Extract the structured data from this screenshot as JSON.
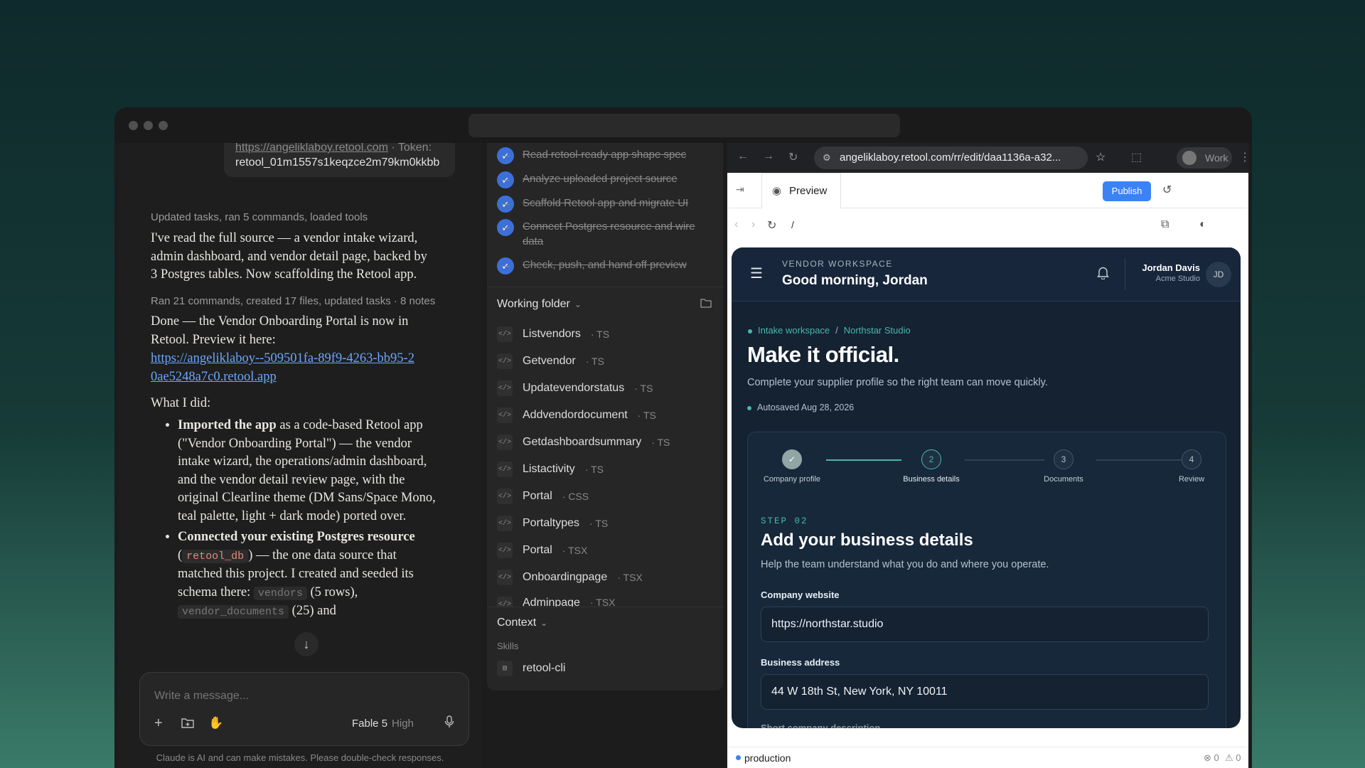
{
  "colors": {
    "accent_teal": "#49b7a9",
    "publish_blue": "#3b82f6",
    "task_check": "#3d6fd8",
    "link": "#6aa7ff"
  },
  "chat": {
    "bubble_link": "https://angeliklaboy.retool.com",
    "bubble_suffix": " · Token:",
    "bubble_token": "retool_01m1557s1keqzce2m79km0kkbb",
    "meta1": "Updated tasks, ran 5 commands, loaded tools",
    "para1": "I've read the full source — a vendor intake wizard, admin dashboard, and vendor detail page, backed by 3 Postgres tables. Now scaffolding the Retool app.",
    "meta2": "Ran 21 commands, created 17 files, updated tasks · 8 notes",
    "para2": "Done — the Vendor Onboarding Portal is now in Retool. Preview it here:",
    "preview_link": "https://angeliklaboy--509501fa-89f9-4263-bb95-20ae5248a7c0.retool.app",
    "what_i_did": "What I did:",
    "b1_bold": "Imported the app",
    "b1_text": " as a code-based Retool app (\"Vendor Onboarding Portal\") — the vendor intake wizard, the operations/admin dashboard, and the vendor detail review page, with the original Clearline theme (DM Sans/Space Mono, teal palette, light + dark mode) ported over.",
    "b2_bold": "Connected your existing Postgres resource",
    "b2_pre": " (",
    "b2_code": "retool_db",
    "b2_text": ") — the one data source that matched this project. I created and seeded its schema there:",
    "b2_code2": "vendors",
    "b2_tail": "(5 rows),",
    "b2_code3": "vendor_documents",
    "b2_tail2": "(25) and",
    "scroll_icon": "arrow-down-icon",
    "input_placeholder": "Write a message...",
    "model": "Fable 5",
    "effort": "High",
    "disclaimer": "Claude is AI and can make mistakes. Please double-check responses."
  },
  "tasks": {
    "items": [
      "Read retool-ready app shape spec",
      "Analyze uploaded project source",
      "Scaffold Retool app and migrate UI",
      "Connect Postgres resource and wire data",
      "Check, push, and hand off preview"
    ],
    "working_folder": "Working folder",
    "files": [
      {
        "name": "Listvendors",
        "ext": "TS"
      },
      {
        "name": "Getvendor",
        "ext": "TS"
      },
      {
        "name": "Updatevendorstatus",
        "ext": "TS"
      },
      {
        "name": "Addvendordocument",
        "ext": "TS"
      },
      {
        "name": "Getdashboardsummary",
        "ext": "TS"
      },
      {
        "name": "Listactivity",
        "ext": "TS"
      },
      {
        "name": "Portal",
        "ext": "CSS"
      },
      {
        "name": "Portaltypes",
        "ext": "TS"
      },
      {
        "name": "Portal",
        "ext": "TSX"
      },
      {
        "name": "Onboardingpage",
        "ext": "TSX"
      },
      {
        "name": "Adminpage",
        "ext": "TSX"
      }
    ],
    "context": "Context",
    "skills": "Skills",
    "skill_item": "retool-cli"
  },
  "browser": {
    "url": "angeliklaboy.retool.com/rr/edit/daa1136a-a32...",
    "profile": "Work",
    "preview_tab": "Preview",
    "publish": "Publish",
    "path": "/",
    "env": "production",
    "errors": "0",
    "warnings": "0"
  },
  "app": {
    "eyebrow": "VENDOR WORKSPACE",
    "greeting": "Good morning, Jordan",
    "user_name": "Jordan Davis",
    "user_org": "Acme Studio",
    "user_initials": "JD",
    "crumb1": "Intake workspace",
    "crumb_sep": "/",
    "crumb2": "Northstar Studio",
    "headline": "Make it official.",
    "subhead": "Complete your supplier profile so the right team can move quickly.",
    "autosaved": "Autosaved Aug 28, 2026",
    "steps": [
      {
        "num": "✓",
        "label": "Company profile"
      },
      {
        "num": "2",
        "label": "Business details"
      },
      {
        "num": "3",
        "label": "Documents"
      },
      {
        "num": "4",
        "label": "Review"
      }
    ],
    "step_eyebrow": "STEP 02",
    "step_title": "Add your business details",
    "step_desc": "Help the team understand what you do and where you operate.",
    "website_label": "Company website",
    "website_value": "https://northstar.studio",
    "address_label": "Business address",
    "address_value": "44 W 18th St, New York, NY 10011",
    "next_label": "Short company description"
  }
}
